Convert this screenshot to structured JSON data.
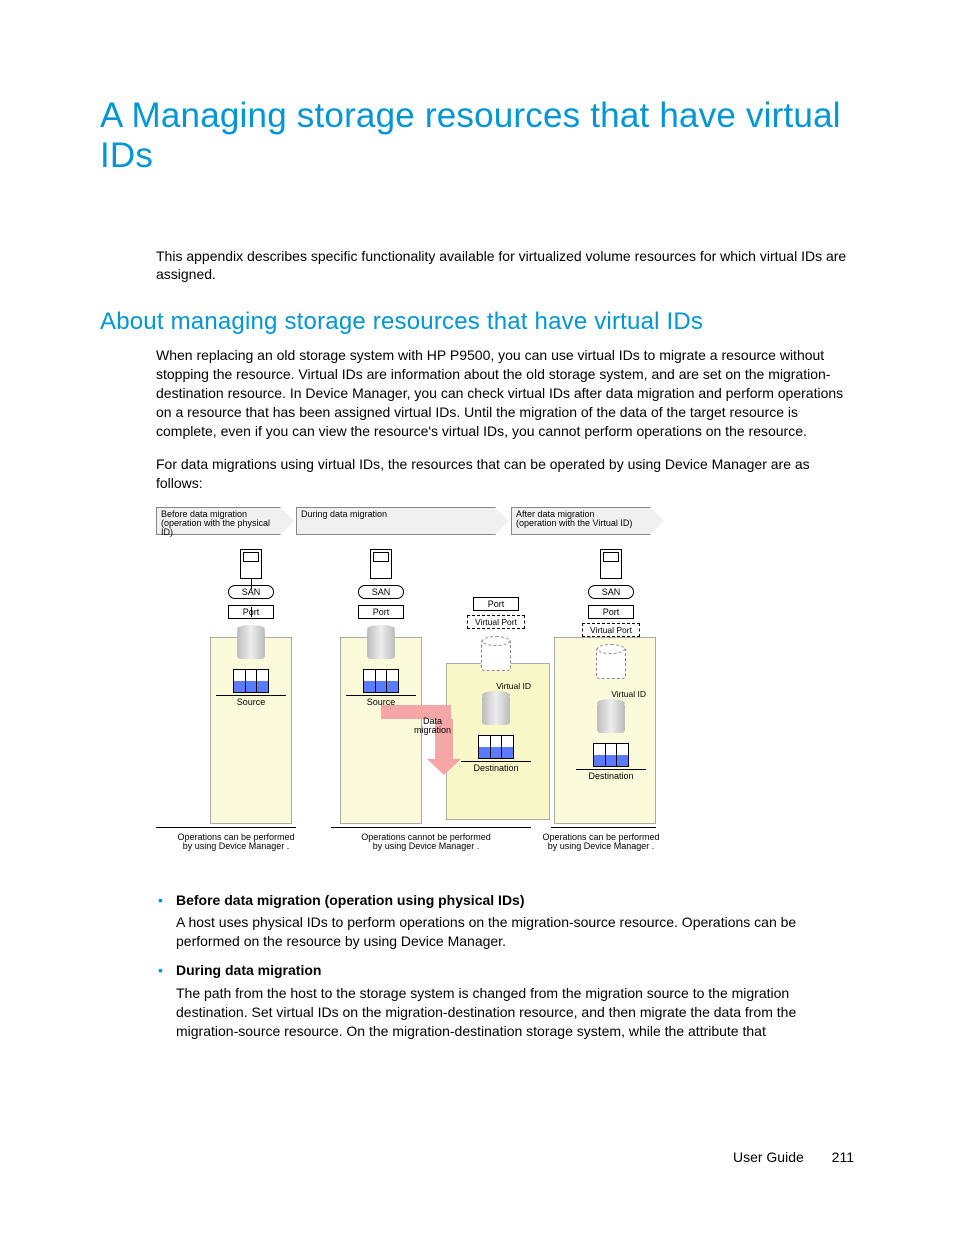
{
  "title": "A Managing storage resources that have virtual IDs",
  "intro": "This appendix describes specific functionality available for virtualized volume resources for which virtual IDs are assigned.",
  "h2": "About managing storage resources that have virtual IDs",
  "p1": "When replacing an old storage system with HP P9500, you can use virtual IDs to migrate a resource without stopping the resource. Virtual IDs are information about the old storage system, and are set on the migration-destination resource. In Device Manager, you can check virtual IDs after data migration and perform operations on a resource that has been assigned virtual IDs. Until the migration of the data of the target resource is complete, even if you can view the resource's virtual IDs, you cannot perform operations on the resource.",
  "p2": "For data migrations using virtual IDs, the resources that can be operated by using Device Manager are as follows:",
  "diagram": {
    "phase1": "Before data migration\n(operation with the physical ID)",
    "phase2": "During data migration",
    "phase3": "After data migration\n(operation with the Virtual ID)",
    "san": "SAN",
    "port": "Port",
    "vport": "Virtual Port",
    "vid": "Virtual ID",
    "dm": "Data\nmigration",
    "source": "Source",
    "destination": "Destination",
    "cap_can": "Operations can be performed\nby using Device Manager .",
    "cap_cannot": "Operations cannot be performed\nby using Device Manager ."
  },
  "bullets": [
    {
      "head": "Before data migration (operation using physical IDs)",
      "body": "A host uses physical IDs to perform operations on the migration-source resource. Operations can be performed on the resource by using Device Manager."
    },
    {
      "head": "During data migration",
      "body": "The path from the host to the storage system is changed from the migration source to the migration destination. Set virtual IDs on the migration-destination resource, and then migrate the data from the migration-source resource. On the migration-destination storage system, while the attribute that"
    }
  ],
  "footer": {
    "label": "User Guide",
    "page": "211"
  }
}
